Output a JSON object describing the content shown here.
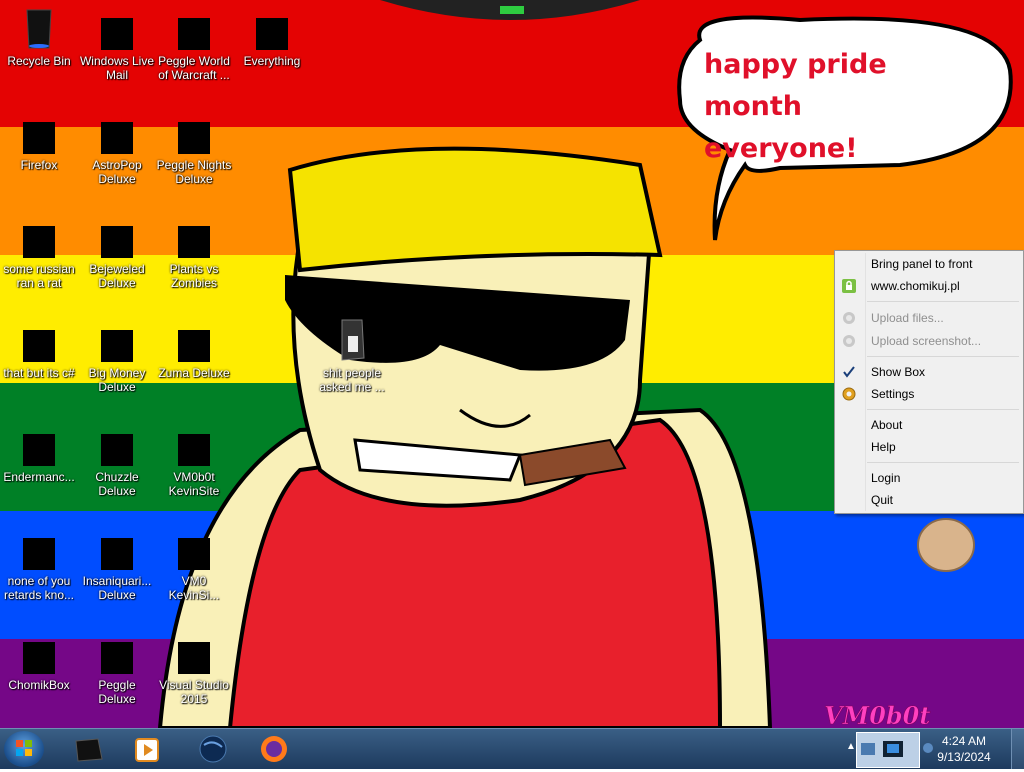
{
  "speech_bubble": {
    "line1": "happy pride month",
    "line2": "everyone!"
  },
  "desktop_icons": [
    {
      "label": "Recycle Bin",
      "icon": "recycle-bin-icon"
    },
    {
      "label": "Windows Live Mail",
      "icon": "mail-icon"
    },
    {
      "label": "Peggle World of Warcraft ...",
      "icon": "peggle-icon"
    },
    {
      "label": "Everything",
      "icon": "search-icon"
    },
    {
      "label": "Firefox",
      "icon": "firefox-icon"
    },
    {
      "label": "AstroPop Deluxe",
      "icon": "game-icon"
    },
    {
      "label": "Peggle Nights Deluxe",
      "icon": "peggle-icon"
    },
    {
      "label": "some russian ran a rat",
      "icon": "app-icon"
    },
    {
      "label": "Bejeweled Deluxe",
      "icon": "gem-icon"
    },
    {
      "label": "Plants vs Zombies",
      "icon": "plant-icon"
    },
    {
      "label": "that but its c#",
      "icon": "shortcut-icon"
    },
    {
      "label": "Big Money Deluxe",
      "icon": "money-bag-icon"
    },
    {
      "label": "Zuma Deluxe",
      "icon": "zuma-icon"
    },
    {
      "label": "Endermanc...",
      "icon": "terminal-icon"
    },
    {
      "label": "Chuzzle Deluxe",
      "icon": "chuzzle-icon"
    },
    {
      "label": "VM0b0t KevinSite",
      "icon": "site-icon"
    },
    {
      "label": "none of you retards kno...",
      "icon": "app-icon"
    },
    {
      "label": "Insaniquari... Deluxe",
      "icon": "fish-icon"
    },
    {
      "label": "VM0 KevinSi...",
      "icon": "file-icon"
    },
    {
      "label": "ChomikBox",
      "icon": "chomikbox-icon"
    },
    {
      "label": "Peggle Deluxe",
      "icon": "peggle-icon"
    },
    {
      "label": "Visual Studio 2015",
      "icon": "visual-studio-icon"
    },
    {
      "label": "shit people asked me ...",
      "icon": "folder-icon"
    }
  ],
  "context_menu": {
    "items": [
      {
        "label": "Bring panel to front"
      },
      {
        "label": "www.chomikuj.pl"
      },
      {
        "label": "Upload files..."
      },
      {
        "label": "Upload screenshot..."
      },
      {
        "label": "Show Box",
        "checked": true
      },
      {
        "label": "Settings"
      },
      {
        "label": "About"
      },
      {
        "label": "Help"
      },
      {
        "label": "Login"
      },
      {
        "label": "Quit"
      }
    ]
  },
  "wallpaper_signature": "VM0b0t",
  "taskbar": {
    "pinned": [
      "explorer-icon",
      "media-player-icon",
      "globe-icon",
      "firefox-icon"
    ],
    "clock": {
      "time": "4:24 AM",
      "date": "9/13/2024"
    }
  },
  "colors": {
    "pride_red": "#e40303",
    "pride_orange": "#ff8c00",
    "pride_yellow": "#ffed00",
    "pride_green": "#008026",
    "pride_blue": "#004dff",
    "pride_purple": "#750787"
  }
}
